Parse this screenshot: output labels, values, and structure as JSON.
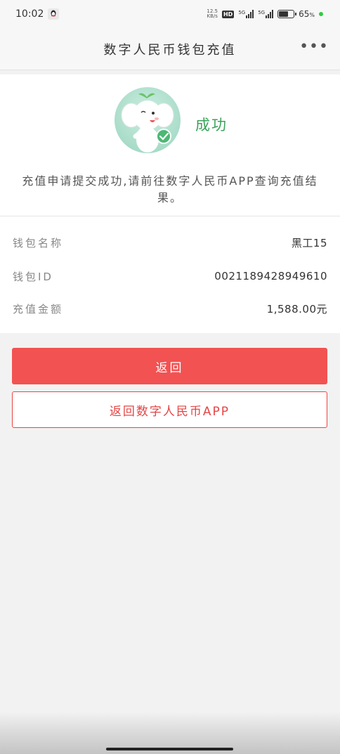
{
  "status_bar": {
    "time": "10:02",
    "net_speed": "12.5",
    "net_unit": "KB/s",
    "hd": "HD",
    "signal_1": "5G",
    "signal_2": "5G",
    "battery": "65",
    "battery_unit": "%"
  },
  "nav": {
    "title": "数字人民币钱包充值",
    "more": "•••"
  },
  "result": {
    "status": "成功",
    "description": "充值申请提交成功,请前往数字人民币APP查询充值结果。"
  },
  "info": [
    {
      "label": "钱包名称",
      "value": "黑工15"
    },
    {
      "label": "钱包ID",
      "value": "0021189428949610"
    },
    {
      "label": "充值金额",
      "value": "1,588.00元"
    }
  ],
  "actions": {
    "back": "返回",
    "back_to_app": "返回数字人民币APP"
  },
  "colors": {
    "primary": "#f25252",
    "success": "#3aa35a"
  }
}
